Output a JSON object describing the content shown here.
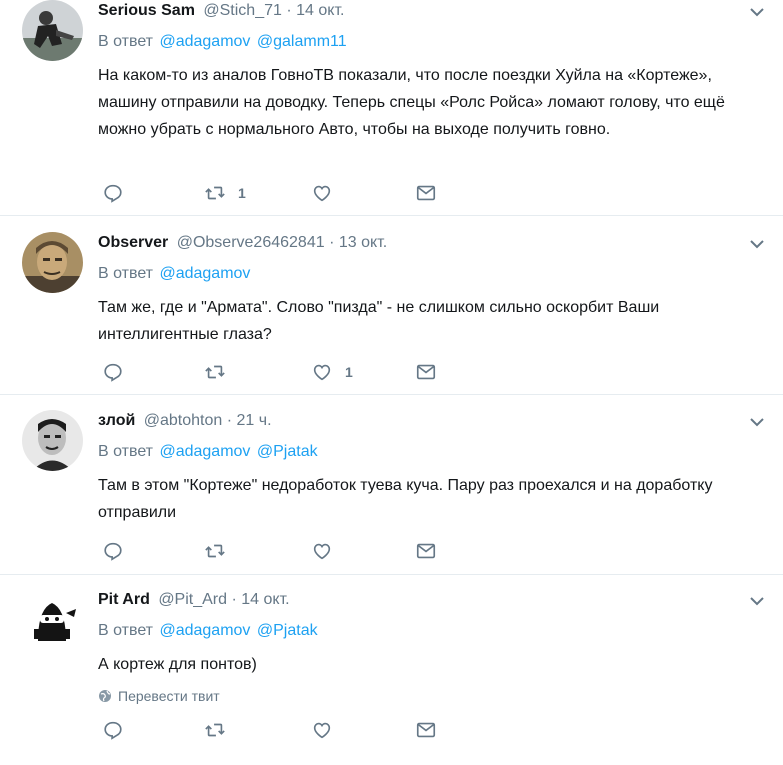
{
  "colors": {
    "link": "#1da1f2",
    "muted": "#657786",
    "text": "#14171a",
    "divider": "#e6ecf0"
  },
  "reply_prefix": "В ответ",
  "translate_label": "Перевести твит",
  "tweets": [
    {
      "name": "Serious Sam",
      "handle": "@Stich_71",
      "time": "14 окт.",
      "mentions": [
        "@adagamov",
        "@galamm11"
      ],
      "text": "На каком-то из аналов ГовноТВ показали, что после поездки Хуйла на «Кортеже», машину отправили на доводку. Теперь спецы «Ролс Ройса» ломают голову, что ещё можно убрать с нормального Авто, чтобы на выходе получить говно.",
      "retweets": "1",
      "likes": ""
    },
    {
      "name": "Observer",
      "handle": "@Observe26462841",
      "time": "13 окт.",
      "mentions": [
        "@adagamov"
      ],
      "text": "Там же, где и \"Армата\". Слово \"пизда\" - не слишком сильно оскорбит Ваши интеллигентные глаза?",
      "retweets": "",
      "likes": "1"
    },
    {
      "name": "злой",
      "handle": "@abtohton",
      "time": "21 ч.",
      "mentions": [
        "@adagamov",
        "@Pjatak"
      ],
      "text": "Там в этом \"Кортеже\" недоработок туева куча. Пару раз проехался и на доработку отправили",
      "retweets": "",
      "likes": ""
    },
    {
      "name": "Pit Ard",
      "handle": "@Pit_Ard",
      "time": "14 окт.",
      "mentions": [
        "@adagamov",
        "@Pjatak"
      ],
      "text": "А кортеж для понтов)",
      "retweets": "",
      "likes": ""
    }
  ]
}
